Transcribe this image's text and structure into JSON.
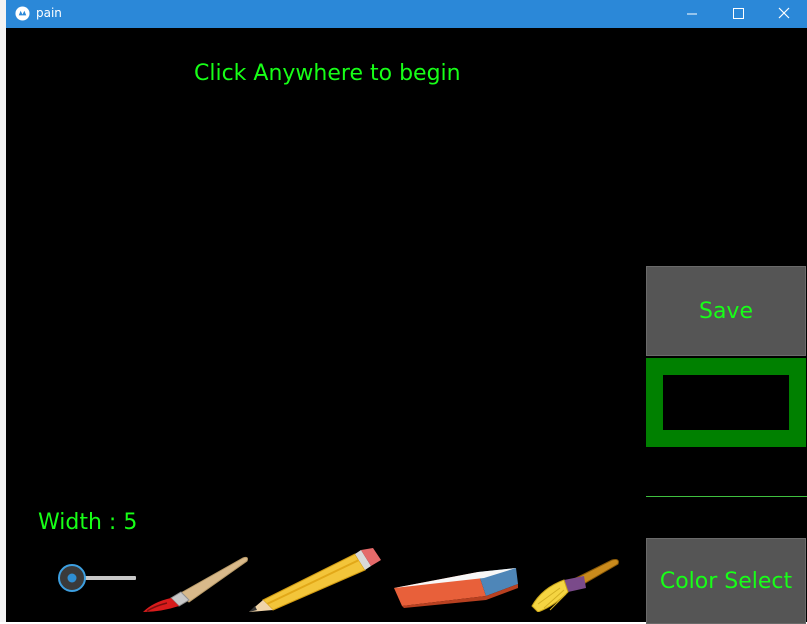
{
  "window": {
    "title": "pain"
  },
  "canvas": {
    "hint": "Click Anywhere to begin",
    "background_color": "#000000",
    "text_color": "#17ff17"
  },
  "width_control": {
    "label": "Width : 5",
    "value": 5
  },
  "tools": [
    {
      "name": "paintbrush-icon"
    },
    {
      "name": "pencil-icon"
    },
    {
      "name": "eraser-icon"
    },
    {
      "name": "broom-icon"
    }
  ],
  "side_panel": {
    "save_label": "Save",
    "color_select_label": "Color Select",
    "current_color": "#008000"
  }
}
